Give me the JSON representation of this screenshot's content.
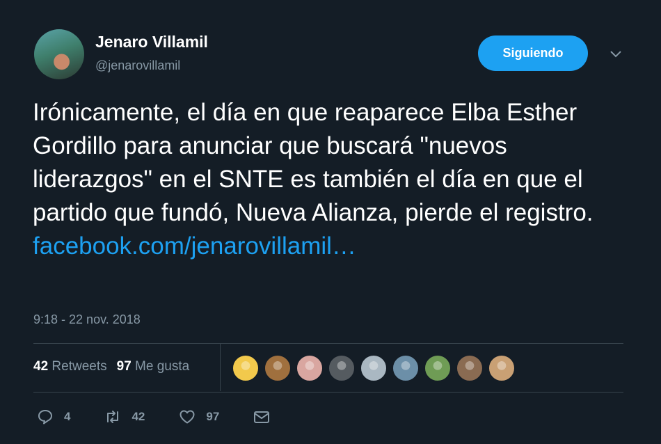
{
  "author": {
    "name": "Jenaro Villamil",
    "handle": "@jenarovillamil"
  },
  "follow_button": {
    "label": "Siguiendo"
  },
  "tweet": {
    "text": "Irónicamente, el día en que reaparece Elba Esther Gordillo para anunciar que buscará \"nuevos liderazgos\" en el SNTE es también el día en que el partido que fundó, Nueva Alianza, pierde el registro.",
    "link": "facebook.com/jenarovillamil…",
    "timestamp": "9:18 - 22 nov. 2018"
  },
  "stats": {
    "retweets_count": "42",
    "retweets_label": "Retweets",
    "likes_count": "97",
    "likes_label": "Me gusta"
  },
  "likers": [
    {
      "icon": "avatar-1",
      "color": "#f2c94c"
    },
    {
      "icon": "avatar-2",
      "color": "#a0703e"
    },
    {
      "icon": "avatar-3",
      "color": "#d9a6a0"
    },
    {
      "icon": "avatar-4",
      "color": "#555b60"
    },
    {
      "icon": "avatar-5",
      "color": "#aab8c2"
    },
    {
      "icon": "avatar-6",
      "color": "#6c8fa8"
    },
    {
      "icon": "avatar-7",
      "color": "#6f9c55"
    },
    {
      "icon": "avatar-8",
      "color": "#8a6b52"
    },
    {
      "icon": "avatar-9",
      "color": "#c9a074"
    }
  ],
  "actions": {
    "reply_count": "4",
    "retweet_count": "42",
    "like_count": "97"
  },
  "colors": {
    "background": "#141d26",
    "accent": "#1da1f2",
    "muted": "#8899a6"
  }
}
